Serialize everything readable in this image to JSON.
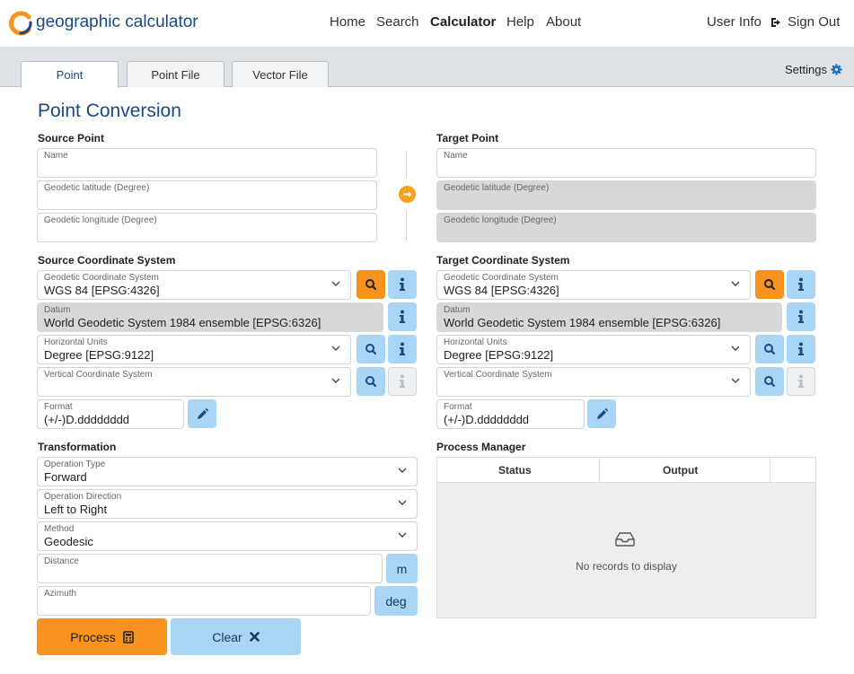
{
  "app": {
    "logo_text": "geographic calculator"
  },
  "nav": {
    "home": "Home",
    "search": "Search",
    "calculator": "Calculator",
    "help": "Help",
    "about": "About",
    "user_info": "User Info",
    "sign_out": "Sign Out"
  },
  "tabs": [
    {
      "label": "Point",
      "active": true
    },
    {
      "label": "Point File"
    },
    {
      "label": "Vector File"
    }
  ],
  "settings_label": "Settings",
  "page_title": "Point Conversion",
  "source_point": {
    "heading": "Source Point",
    "name_label": "Name",
    "lat_label": "Geodetic latitude (Degree)",
    "lon_label": "Geodetic longitude (Degree)"
  },
  "target_point": {
    "heading": "Target Point",
    "name_label": "Name",
    "lat_label": "Geodetic latitude (Degree)",
    "lon_label": "Geodetic longitude (Degree)"
  },
  "source_cs": {
    "heading": "Source Coordinate System",
    "geo_label": "Geodetic Coordinate System",
    "geo_value": "WGS 84 [EPSG:4326]",
    "datum_label": "Datum",
    "datum_value": "World Geodetic System 1984 ensemble [EPSG:6326]",
    "hunits_label": "Horizontal Units",
    "hunits_value": "Degree [EPSG:9122]",
    "vcs_label": "Vertical Coordinate System",
    "vcs_value": "",
    "format_label": "Format",
    "format_value": "(+/-)D.dddddddd"
  },
  "target_cs": {
    "heading": "Target Coordinate System",
    "geo_label": "Geodetic Coordinate System",
    "geo_value": "WGS 84 [EPSG:4326]",
    "datum_label": "Datum",
    "datum_value": "World Geodetic System 1984 ensemble [EPSG:6326]",
    "hunits_label": "Horizontal Units",
    "hunits_value": "Degree [EPSG:9122]",
    "vcs_label": "Vertical Coordinate System",
    "vcs_value": "",
    "format_label": "Format",
    "format_value": "(+/-)D.dddddddd"
  },
  "transformation": {
    "heading": "Transformation",
    "op_type_label": "Operation Type",
    "op_type_value": "Forward",
    "op_dir_label": "Operation Direction",
    "op_dir_value": "Left to Right",
    "method_label": "Method",
    "method_value": "Geodesic",
    "distance_label": "Distance",
    "distance_unit": "m",
    "azimuth_label": "Azimuth",
    "azimuth_unit": "deg"
  },
  "process_manager": {
    "heading": "Process Manager",
    "columns": [
      "Status",
      "Output"
    ],
    "empty_text": "No records to display"
  },
  "buttons": {
    "process": "Process",
    "clear": "Clear"
  },
  "colors": {
    "brand": "#1b4a82",
    "accent_orange": "#f7931e",
    "accent_blue": "#a9d5f7"
  },
  "icons": [
    "logo-icon",
    "sign-out-icon",
    "gear-icon",
    "arrow-right-icon",
    "search-icon",
    "info-icon",
    "chevron-down-icon",
    "pencil-icon",
    "calculator-icon",
    "close-icon",
    "inbox-icon"
  ]
}
